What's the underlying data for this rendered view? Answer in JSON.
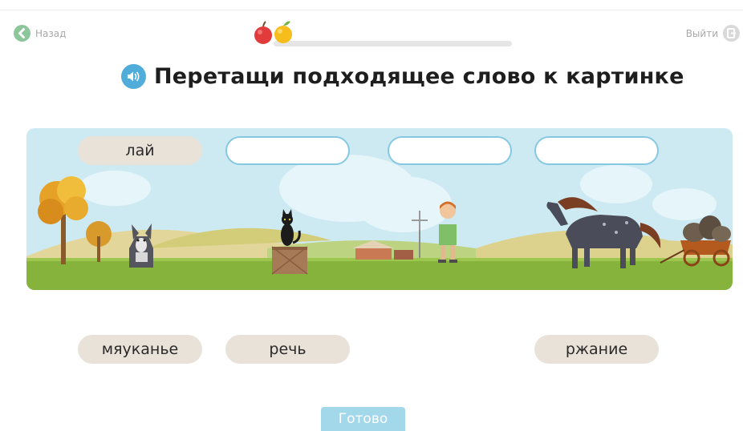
{
  "nav": {
    "back_label": "Назад",
    "back_icon": "chevron-left-icon",
    "exit_label": "Выйти",
    "exit_icon": "exit-door-icon"
  },
  "progress": {
    "completed_fraction": 0.1
  },
  "task": {
    "title": "Перетащи подходящее слово к картинке",
    "audio_icon": "speaker-icon"
  },
  "placed_word": "лай",
  "answer_slots": [
    "",
    "",
    ""
  ],
  "word_bank": [
    "мяуканье",
    "речь",
    "ржание"
  ],
  "submit": {
    "label": "Готово"
  },
  "colors": {
    "accent_blue": "#50acd8",
    "slot_border": "#86c8e2",
    "word_chip": "#e9e2d9",
    "back_green": "#8cc69b",
    "done_button": "#a3d7ea",
    "sky": "#cdeaf3",
    "grass": "#86b33b"
  }
}
